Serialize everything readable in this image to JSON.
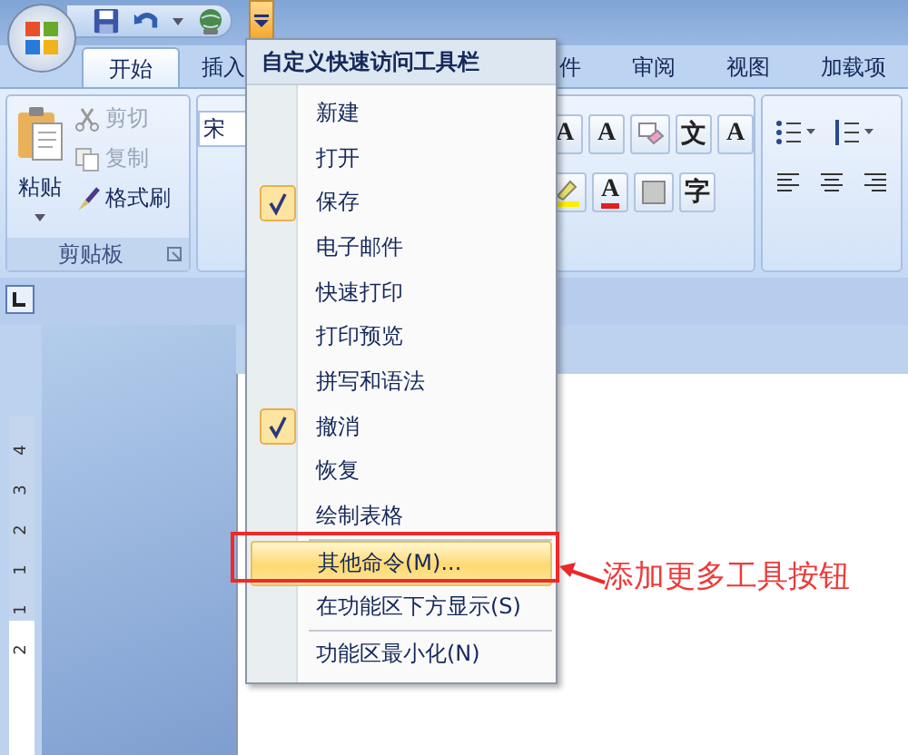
{
  "tabs": [
    {
      "label": "开始",
      "selected": true
    },
    {
      "label": "插入",
      "selected": false
    },
    {
      "label": "件",
      "selected": false
    },
    {
      "label": "审阅",
      "selected": false
    },
    {
      "label": "视图",
      "selected": false
    },
    {
      "label": "加载项",
      "selected": false
    }
  ],
  "clipboard": {
    "paste": "粘贴",
    "group_label": "剪贴板",
    "actions": [
      {
        "kind": "cut",
        "label": "剪切",
        "disabled": true
      },
      {
        "kind": "copy",
        "label": "复制",
        "disabled": true
      },
      {
        "kind": "painter",
        "label": "格式刷",
        "disabled": false
      }
    ]
  },
  "font_group": {
    "font_box": "宋",
    "row1": [
      {
        "kind": "grow",
        "glyph": "A"
      },
      {
        "kind": "shrink",
        "glyph": "A"
      },
      {
        "kind": "clear"
      },
      {
        "kind": "phonetic",
        "glyph": "文"
      },
      {
        "kind": "border",
        "glyph": "A"
      }
    ],
    "row2": [
      {
        "kind": "highlight"
      },
      {
        "kind": "color",
        "glyph": "A"
      },
      {
        "kind": "shade"
      },
      {
        "kind": "enclose",
        "glyph": "字"
      }
    ]
  },
  "ruler_numbers": [
    "4",
    "3",
    "2",
    "1",
    "1",
    "2"
  ],
  "menu": {
    "title": "自定义快速访问工具栏",
    "items": [
      {
        "kind": "item",
        "label": "新建",
        "checked": false,
        "selected": false
      },
      {
        "kind": "item",
        "label": "打开",
        "checked": false,
        "selected": false
      },
      {
        "kind": "item",
        "label": "保存",
        "checked": true,
        "selected": false
      },
      {
        "kind": "item",
        "label": "电子邮件",
        "checked": false,
        "selected": false
      },
      {
        "kind": "item",
        "label": "快速打印",
        "checked": false,
        "selected": false
      },
      {
        "kind": "item",
        "label": "打印预览",
        "checked": false,
        "selected": false
      },
      {
        "kind": "item",
        "label": "拼写和语法",
        "checked": false,
        "selected": false
      },
      {
        "kind": "item",
        "label": "撤消",
        "checked": true,
        "selected": false
      },
      {
        "kind": "item",
        "label": "恢复",
        "checked": false,
        "selected": false
      },
      {
        "kind": "item",
        "label": "绘制表格",
        "checked": false,
        "selected": false
      },
      {
        "kind": "separator"
      },
      {
        "kind": "item",
        "label": "其他命令(M)...",
        "checked": false,
        "selected": true
      },
      {
        "kind": "item",
        "label": "在功能区下方显示(S)",
        "checked": false,
        "selected": false
      },
      {
        "kind": "separator"
      },
      {
        "kind": "item",
        "label": "功能区最小化(N)",
        "checked": false,
        "selected": false
      }
    ]
  },
  "annotation": {
    "text": "添加更多工具按钮"
  }
}
